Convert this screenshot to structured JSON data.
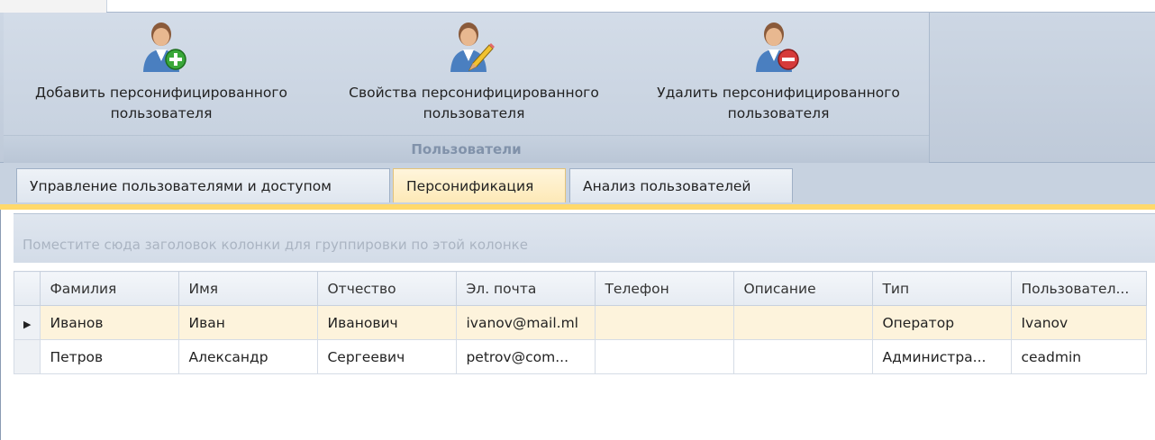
{
  "ribbon": {
    "buttons": {
      "add": {
        "label": "Добавить персонифицированного пользователя"
      },
      "props": {
        "label": "Свойства персонифицированного пользователя"
      },
      "delete": {
        "label": "Удалить персонифицированного пользователя"
      }
    },
    "group_label": "Пользователи"
  },
  "tabs": [
    {
      "label": "Управление пользователями и доступом",
      "active": false
    },
    {
      "label": "Персонификация",
      "active": true
    },
    {
      "label": "Анализ пользователей",
      "active": false
    }
  ],
  "grid": {
    "group_hint": "Поместите сюда заголовок колонки для группировки по этой колонке",
    "columns": [
      "Фамилия",
      "Имя",
      "Отчество",
      "Эл. почта",
      "Телефон",
      "Описание",
      "Тип",
      "Пользовател..."
    ],
    "rows": [
      {
        "active": true,
        "cells": [
          "Иванов",
          "Иван",
          "Иванович",
          "ivanov@mail.ml",
          "",
          "",
          "Оператор",
          "Ivanov"
        ]
      },
      {
        "active": false,
        "cells": [
          "Петров",
          "Александр",
          "Сергеевич",
          "petrov@com...",
          "",
          "",
          "Администра...",
          "ceadmin"
        ]
      }
    ],
    "row_indicator": "▶"
  },
  "icons": {
    "add": "user-add-icon",
    "props": "user-edit-icon",
    "delete": "user-delete-icon"
  },
  "colors": {
    "active_tab": "#fde9b7",
    "active_row": "#fdf3dc",
    "ribbon_bg": "#c5d0de"
  }
}
